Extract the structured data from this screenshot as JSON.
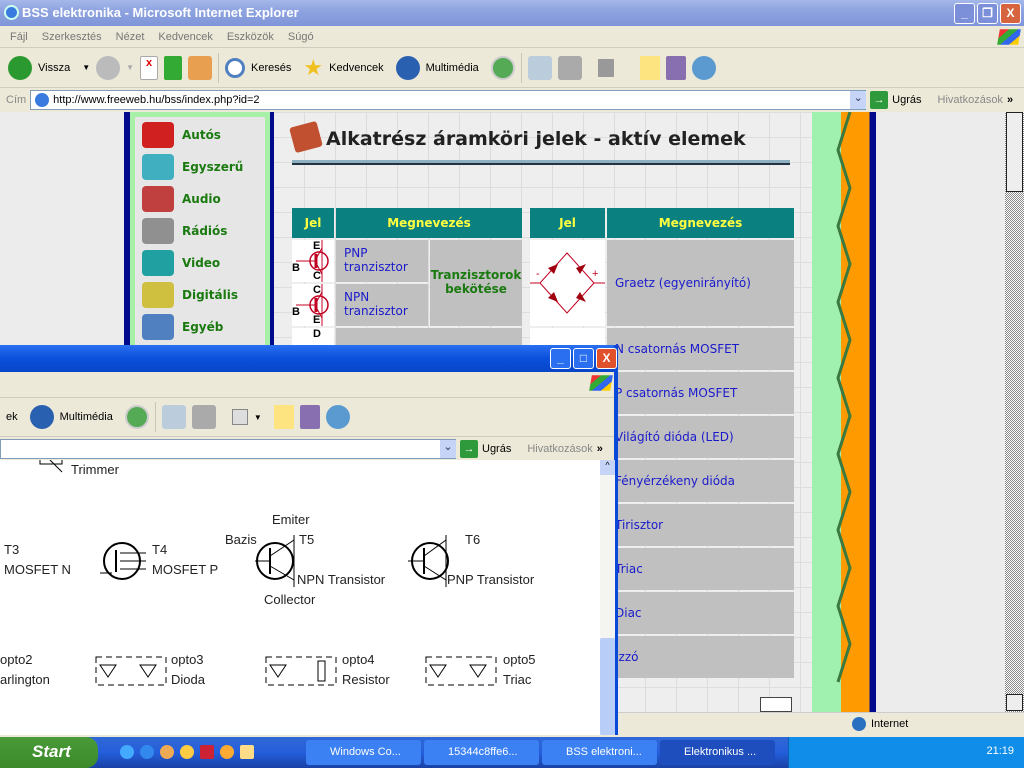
{
  "window": {
    "title": "BSS elektronika - Microsoft Internet Explorer",
    "minimize": "_",
    "maximize": "❐",
    "close": "X"
  },
  "menu": [
    "Fájl",
    "Szerkesztés",
    "Nézet",
    "Kedvencek",
    "Eszközök",
    "Súgó"
  ],
  "toolbar": {
    "back": "Vissza",
    "search": "Keresés",
    "favorites": "Kedvencek",
    "media": "Multimédia"
  },
  "address": {
    "label": "Cím",
    "url": "http://www.freeweb.hu/bss/index.php?id=2",
    "go": "Ugrás",
    "links": "Hivatkozások",
    "more": "»"
  },
  "nav": [
    {
      "label": "Autós",
      "color": "#d02020"
    },
    {
      "label": "Egyszerű",
      "color": "#40b0c0"
    },
    {
      "label": "Audio",
      "color": "#c04040"
    },
    {
      "label": "Rádiós",
      "color": "#909090"
    },
    {
      "label": "Video",
      "color": "#20a0a0"
    },
    {
      "label": "Digitális",
      "color": "#d0c040"
    },
    {
      "label": "Egyéb",
      "color": "#5080c0"
    }
  ],
  "page": {
    "title": "Alkatrész áramköri jelek - aktív elemek"
  },
  "table": {
    "headers": [
      "Jel",
      "Megnevezés",
      "Jel",
      "Megnevezés"
    ],
    "left_rows": [
      {
        "symbol": "PNP",
        "pins": [
          "E",
          "B",
          "C"
        ],
        "name": "PNP tranzisztor"
      },
      {
        "symbol": "NPN",
        "pins": [
          "C",
          "B",
          "E"
        ],
        "name": "NPN tranzisztor"
      }
    ],
    "group_label": "Tranzisztorok bekötése",
    "third_pin": "D",
    "right_rows": [
      "Graetz (egyenirányító)",
      "N csatornás MOSFET",
      "P csatornás MOSFET",
      "Világító dióda (LED)",
      "Fényérzékeny dióda",
      "Tirisztor",
      "Triac",
      "Diac",
      "Izzó"
    ],
    "graetz_signs": [
      "-",
      "+"
    ]
  },
  "status": {
    "zone": "Internet"
  },
  "window2": {
    "go": "Ugrás",
    "links": "Hivatkozások",
    "more": "»",
    "media": "Multimédia",
    "labels": {
      "trimmer": "Trimmer",
      "t3": "T3",
      "mosfet_n": "MOSFET N",
      "t4": "T4",
      "mosfet_p": "MOSFET P",
      "emiter": "Emiter",
      "bazis": "Bazis",
      "t5": "T5",
      "npn": "NPN Transistor",
      "collector": "Collector",
      "t6": "T6",
      "pnp": "PNP Transistor",
      "opto2": "opto2",
      "darlington": "arlington",
      "opto3": "opto3",
      "dioda": "Dioda",
      "opto4": "opto4",
      "resistor": "Resistor",
      "opto5": "opto5",
      "triac": "Triac"
    }
  },
  "taskbar": {
    "start": "Start",
    "tasks": [
      "Windows Co...",
      "15344c8ffe6...",
      "BSS elektroni...",
      "Elektronikus ..."
    ],
    "clock": "21:19"
  }
}
